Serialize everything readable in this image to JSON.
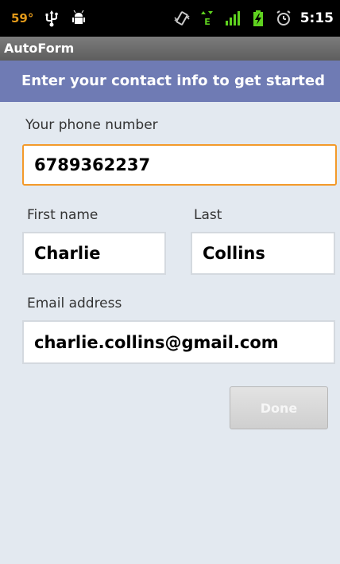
{
  "status_bar": {
    "temperature": "59°",
    "time": "5:15",
    "icons": [
      "usb-icon",
      "android-debug-icon",
      "vibrate-icon",
      "data-edge-icon",
      "signal-icon",
      "battery-charging-icon",
      "alarm-icon"
    ],
    "colors": {
      "temperature": "#e39a1a",
      "signal": "#5fd21f",
      "battery": "#5fd21f"
    }
  },
  "app": {
    "title": "AutoForm"
  },
  "banner": {
    "text": "Enter your contact info to get started",
    "color": "#6f7bb4"
  },
  "form": {
    "phone": {
      "label": "Your phone number",
      "value": "6789362237"
    },
    "first_name": {
      "label": "First name",
      "value": "Charlie"
    },
    "last_name": {
      "label": "Last",
      "value": "Collins"
    },
    "email": {
      "label": "Email address",
      "value": "charlie.collins@gmail.com"
    },
    "focus_color": "#f39a2a"
  },
  "actions": {
    "done_label": "Done",
    "done_enabled": false
  }
}
